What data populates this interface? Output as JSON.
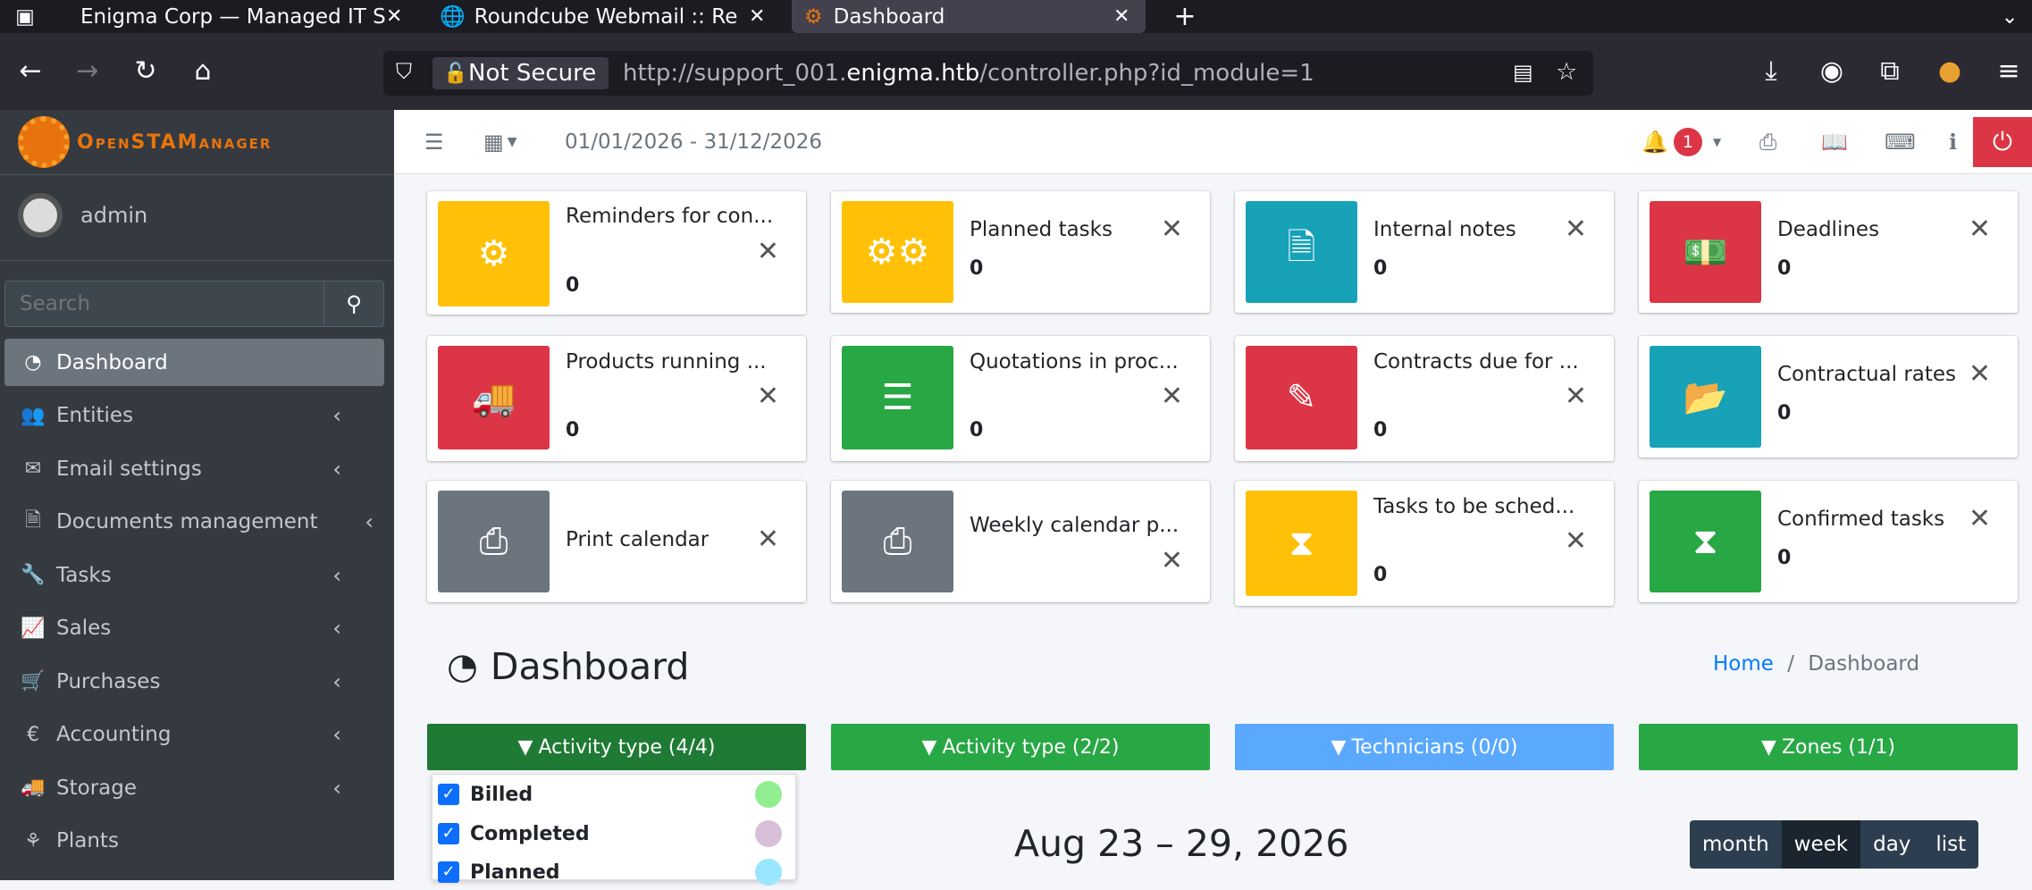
{
  "browser": {
    "tabs": [
      {
        "label": "Enigma Corp — Managed IT S",
        "active": false
      },
      {
        "label": "Roundcube Webmail :: Re",
        "active": false
      },
      {
        "label": "Dashboard",
        "active": true
      }
    ],
    "security_label": "Not Secure",
    "url_prefix": "http://support_001.",
    "url_domain": "enigma.htb",
    "url_suffix": "/controller.php?id_module=1"
  },
  "sidebar": {
    "logo_text": "OpenSTAManager",
    "user": "admin",
    "search_placeholder": "Search",
    "items": [
      {
        "label": "Dashboard",
        "icon": "dashboard-icon",
        "active": true
      },
      {
        "label": "Entities",
        "icon": "users-icon"
      },
      {
        "label": "Email settings",
        "icon": "envelope-icon"
      },
      {
        "label": "Documents management",
        "icon": "document-icon"
      },
      {
        "label": "Tasks",
        "icon": "wrench-icon"
      },
      {
        "label": "Sales",
        "icon": "chart-line-icon"
      },
      {
        "label": "Purchases",
        "icon": "cart-icon"
      },
      {
        "label": "Accounting",
        "icon": "euro-icon"
      },
      {
        "label": "Storage",
        "icon": "truck-icon"
      },
      {
        "label": "Plants",
        "icon": "plant-icon"
      }
    ]
  },
  "topbar": {
    "date_range": "01/01/2026 - 31/12/2026",
    "notification_count": "1"
  },
  "widgets": [
    {
      "title": "Reminders for con...",
      "value": "0",
      "color": "#ffc107",
      "icon": "gear-icon"
    },
    {
      "title": "Planned tasks",
      "value": "0",
      "color": "#ffc107",
      "icon": "gears-icon"
    },
    {
      "title": "Internal notes",
      "value": "0",
      "color": "#17a2b8",
      "icon": "file-text-icon"
    },
    {
      "title": "Deadlines",
      "value": "0",
      "color": "#dc3545",
      "icon": "money-bill-icon"
    },
    {
      "title": "Products running ...",
      "value": "0",
      "color": "#dc3545",
      "icon": "truck-icon"
    },
    {
      "title": "Quotations in proc...",
      "value": "0",
      "color": "#28a745",
      "icon": "list-icon"
    },
    {
      "title": "Contracts due for ...",
      "value": "0",
      "color": "#dc3545",
      "icon": "edit-icon"
    },
    {
      "title": "Contractual rates",
      "value": "0",
      "color": "#17a2b8",
      "icon": "folder-open-icon"
    },
    {
      "title": "Print calendar",
      "value": "",
      "color": "#6c757d",
      "icon": "print-icon"
    },
    {
      "title": "Weekly calendar p...",
      "value": "",
      "color": "#6c757d",
      "icon": "print-icon"
    },
    {
      "title": "Tasks to be sched...",
      "value": "0",
      "color": "#ffc107",
      "icon": "hourglass-icon"
    },
    {
      "title": "Confirmed tasks",
      "value": "0",
      "color": "#28a745",
      "icon": "hourglass-icon"
    }
  ],
  "page": {
    "title": "Dashboard",
    "breadcrumb_home": "Home",
    "breadcrumb_sep": "/",
    "breadcrumb_current": "Dashboard"
  },
  "filters": [
    {
      "label": "Activity type (4/4)",
      "color": "#1f7a34"
    },
    {
      "label": "Activity type (2/2)",
      "color": "#28a745"
    },
    {
      "label": "Technicians (0/0)",
      "color": "#5aa9ff"
    },
    {
      "label": "Zones (1/1)",
      "color": "#28a745"
    }
  ],
  "activity_options": [
    {
      "label": "Billed",
      "color": "#90ee90"
    },
    {
      "label": "Completed",
      "color": "#d8bfd8"
    },
    {
      "label": "Planned",
      "color": "#99e6ff"
    }
  ],
  "calendar": {
    "range": "Aug 23 – 29, 2026",
    "views": [
      "month",
      "week",
      "day",
      "list"
    ],
    "active_view": "week"
  }
}
